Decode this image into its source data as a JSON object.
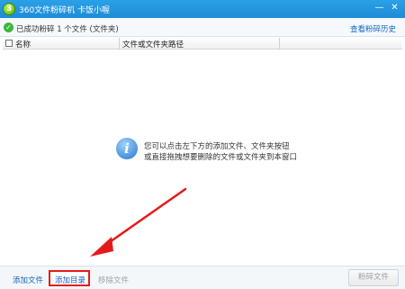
{
  "window": {
    "title": "360文件粉碎机  卡饭小喔",
    "min_symbol": "—",
    "close_symbol": "✕"
  },
  "status": {
    "check_symbol": "✓",
    "text": "已成功粉碎 1 个文件 (文件夹)",
    "history_link": "查看粉碎历史"
  },
  "table": {
    "col_name": "名称",
    "col_path": "文件或文件夹路径"
  },
  "hint": {
    "icon_symbol": "i",
    "line1": "您可以点击左下方的添加文件、文件夹按钮",
    "line2": "或直接拖拽想要删除的文件或文件夹到本窗口"
  },
  "toolbar": {
    "add_file": "添加文件",
    "add_dir": "添加目录",
    "remove_file": "移除文件",
    "shred": "粉碎文件"
  },
  "colors": {
    "title_bar": "#1e8bd7",
    "highlight_box": "#e41b1b",
    "link": "#1565c0",
    "disabled": "#9aa0a6"
  }
}
